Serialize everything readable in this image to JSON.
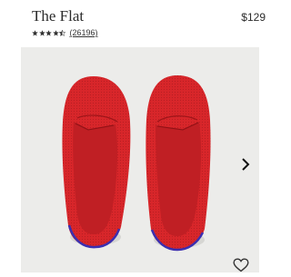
{
  "product": {
    "title": "The Flat",
    "price": "$129",
    "rating_value": 4.5,
    "review_count": "(26196)"
  },
  "colors": {
    "shoe_red": "#d8262a",
    "heel_tab": "#3b2fb0",
    "background": "#ececea"
  },
  "icons": {
    "next": "chevron-right-icon",
    "favorite": "heart-outline-icon",
    "rating": "star-icon"
  }
}
